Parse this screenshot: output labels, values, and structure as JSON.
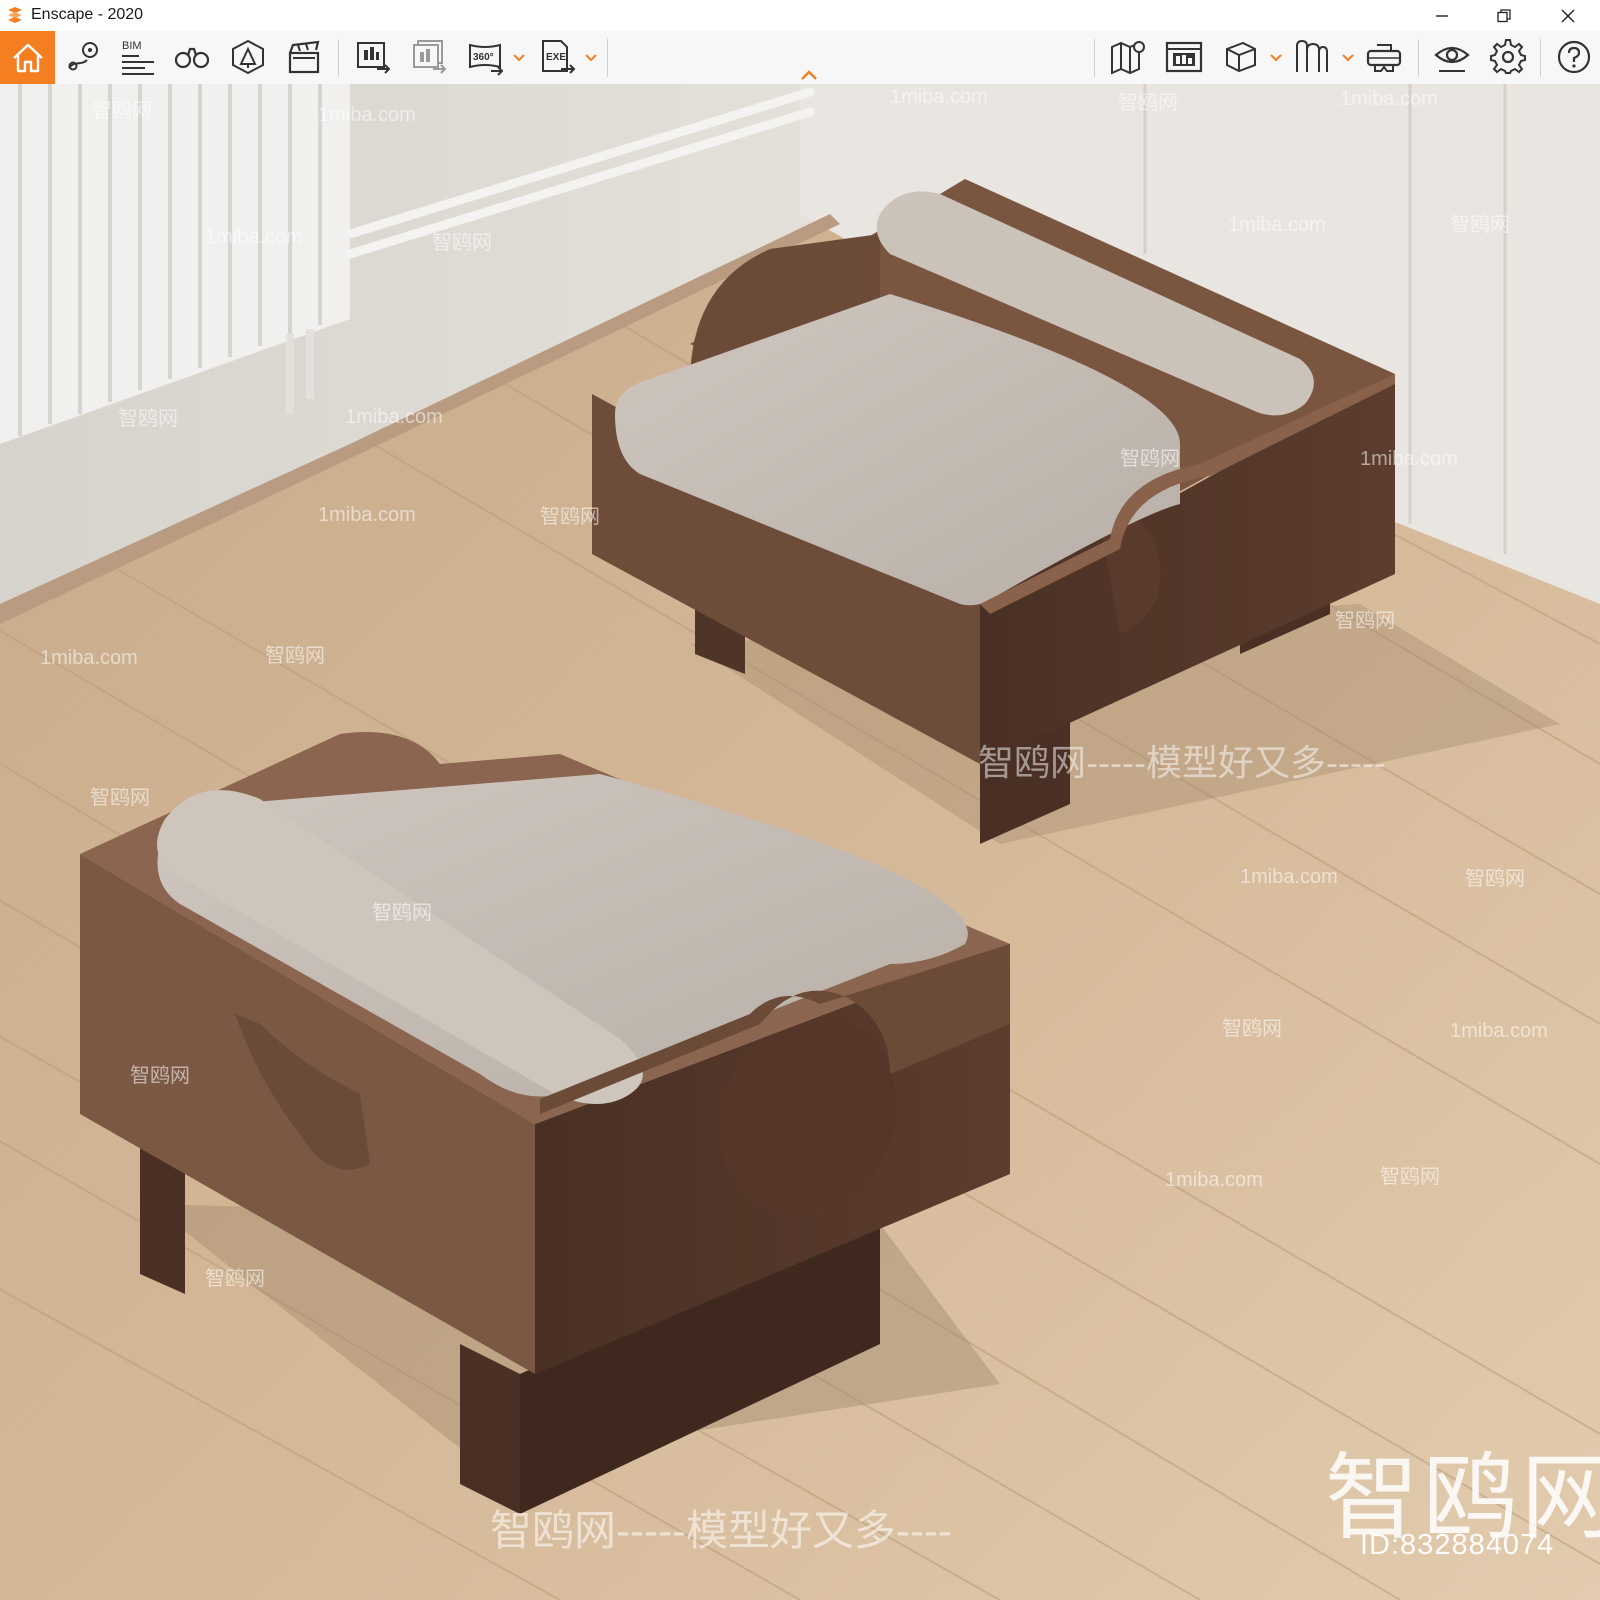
{
  "window": {
    "title": "Enscape - 2020",
    "minimize_icon": "minimize-icon",
    "restore_icon": "restore-icon",
    "close_icon": "close-icon"
  },
  "toolbar": {
    "groups": [
      {
        "items": [
          "home-icon",
          "location-pin-icon",
          "bim-icon",
          "binoculars-icon",
          "asset-library-icon",
          "clapperboard-icon"
        ]
      },
      {
        "items": [
          "export-image-icon",
          "batch-render-icon",
          "panorama-360-icon",
          "export-exe-icon"
        ]
      },
      {
        "items": [
          "map-icon",
          "views-manager-icon",
          "cube-icon",
          "bookmarks-icon",
          "vr-headset-icon"
        ]
      },
      {
        "items": [
          "eye-icon",
          "settings-gear-icon",
          "help-icon"
        ]
      }
    ],
    "bim_label": "BIM",
    "panorama_label": "360°",
    "exe_label": "EXE",
    "accent_color": "#f47e20"
  },
  "viewport": {
    "description_icon": "render-viewport",
    "watermarks": {
      "small": [
        "智鸥网",
        "1miba.com"
      ],
      "middle": "智鸥网-----模型好又多-----",
      "bottom": "智鸥网-----模型好又多----",
      "brand": "智鸥网",
      "id": "ID:832884074"
    }
  }
}
